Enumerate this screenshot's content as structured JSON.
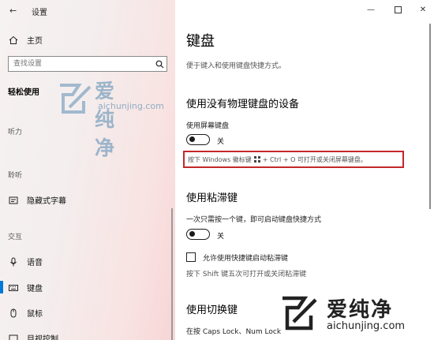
{
  "window": {
    "title": "设置",
    "back_icon": "back-arrow-icon"
  },
  "nav": {
    "home_label": "主页",
    "search_placeholder": "查找设置",
    "section_title": "轻松使用",
    "groups": [
      {
        "label": "听力"
      },
      {
        "label": "聆听",
        "items": [
          {
            "label": "隐藏式字幕"
          }
        ]
      },
      {
        "label": "交互",
        "items": [
          {
            "label": "语音"
          },
          {
            "label": "键盘"
          },
          {
            "label": "鼠标"
          },
          {
            "label": "目视控制"
          }
        ]
      }
    ],
    "selected": "键盘"
  },
  "main": {
    "title": "键盘",
    "subtitle": "便于键入和使用键盘快捷方式。",
    "osk": {
      "heading": "使用没有物理键盘的设备",
      "toggle_label": "使用屏幕键盘",
      "toggle_state": "关",
      "hint_before": "按下 Windows 徽标键",
      "hint_after": "+ Ctrl + O 可打开或关闭屏幕键盘。"
    },
    "sticky": {
      "heading": "使用粘滞键",
      "toggle_label": "一次只需按一个键，即可启动键盘快捷方式",
      "toggle_state": "关",
      "checkbox_label": "允许使用快捷键启动粘滞键",
      "hint": "按下 Shift 键五次可打开或关闭粘滞键"
    },
    "toggle_keys": {
      "heading": "使用切换键",
      "text": "在按 Caps Lock、Num Lock"
    }
  },
  "watermark": {
    "cn": "爱纯净",
    "en": "aichunjing.com"
  },
  "colors": {
    "accent": "#0078d7",
    "highlight_border": "#c4272a",
    "watermark_blue": "#7fa3c0"
  }
}
